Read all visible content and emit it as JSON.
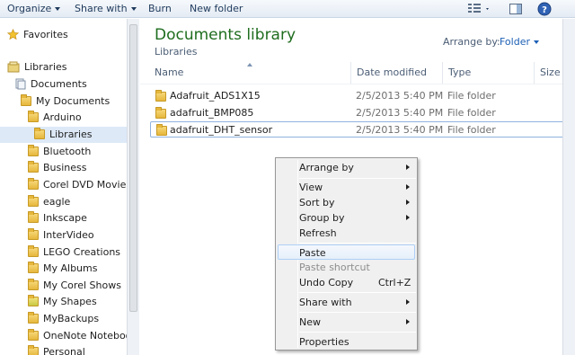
{
  "toolbar": {
    "organize": "Organize",
    "share_with": "Share with",
    "burn": "Burn",
    "new_folder": "New folder"
  },
  "nav": {
    "favorites": "Favorites",
    "libraries": "Libraries",
    "documents": "Documents",
    "my_documents": "My Documents",
    "folders": [
      "Arduino",
      "Libraries",
      "Bluetooth",
      "Business",
      "Corel DVD MovieFac",
      "eagle",
      "Inkscape",
      "InterVideo",
      "LEGO Creations",
      "My Albums",
      "My Corel Shows",
      "My Shapes",
      "MyBackups",
      "OneNote Notebooks",
      "Personal"
    ]
  },
  "main": {
    "title": "Documents library",
    "subtitle": "Libraries",
    "arrange_by_label": "Arrange by:",
    "arrange_by_value": "Folder",
    "columns": {
      "name": "Name",
      "date_modified": "Date modified",
      "type": "Type",
      "size": "Size"
    },
    "rows": [
      {
        "name": "Adafruit_ADS1X15",
        "date": "2/5/2013 5:40 PM",
        "type": "File folder"
      },
      {
        "name": "adafruit_BMP085",
        "date": "2/5/2013 5:40 PM",
        "type": "File folder"
      },
      {
        "name": "adafruit_DHT_sensor",
        "date": "2/5/2013 5:40 PM",
        "type": "File folder"
      }
    ]
  },
  "context_menu": {
    "arrange_by": "Arrange by",
    "view": "View",
    "sort_by": "Sort by",
    "group_by": "Group by",
    "refresh": "Refresh",
    "paste": "Paste",
    "paste_shortcut": "Paste shortcut",
    "undo_copy": "Undo Copy",
    "undo_copy_shortcut": "Ctrl+Z",
    "share_with": "Share with",
    "new": "New",
    "properties": "Properties"
  }
}
